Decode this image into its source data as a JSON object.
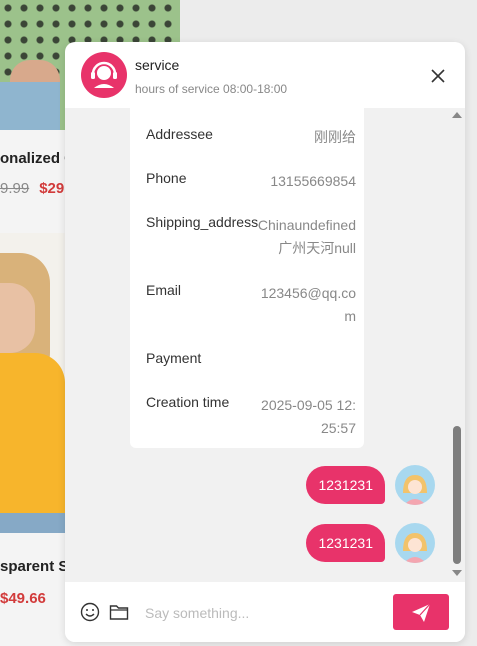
{
  "background": {
    "product1": {
      "title": "onalized C",
      "old_price": "9.99",
      "new_price": "$29"
    },
    "product2": {
      "title": "sparent Sc",
      "price": "$49.66"
    }
  },
  "chat": {
    "header": {
      "name": "service",
      "hours": "hours of service 08:00-18:00",
      "close_icon": "close-icon",
      "avatar_icon": "headset-agent-icon"
    },
    "order": [
      {
        "label": "Addressee",
        "value": "刚刚给"
      },
      {
        "label": "Phone",
        "value": "13155669854"
      },
      {
        "label": "Shipping_address",
        "value": "Chinaundefined广州天河null"
      },
      {
        "label": "Email",
        "value": "123456@qq.com"
      },
      {
        "label": "Payment",
        "value": ""
      },
      {
        "label": "Creation time",
        "value": "2025-09-05 12:25:57"
      }
    ],
    "messages": [
      {
        "text": "1231231"
      },
      {
        "text": "1231231"
      }
    ],
    "footer": {
      "placeholder": "Say something...",
      "emoji_icon": "emoji-icon",
      "folder_icon": "folder-icon",
      "send_icon": "send-icon"
    },
    "colors": {
      "accent": "#e8336a"
    }
  }
}
